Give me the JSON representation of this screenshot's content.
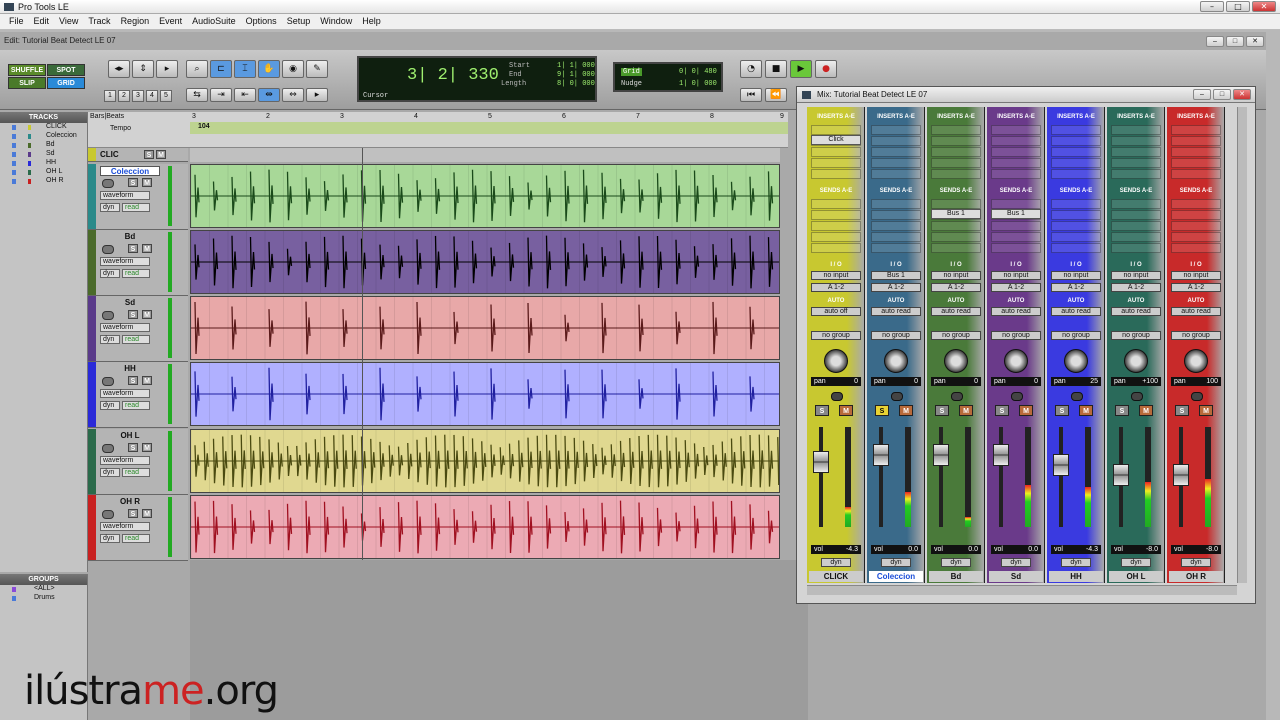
{
  "app_title": "Pro Tools LE",
  "menu": [
    "File",
    "Edit",
    "View",
    "Track",
    "Region",
    "Event",
    "AudioSuite",
    "Options",
    "Setup",
    "Window",
    "Help"
  ],
  "edit_window": {
    "title": "Edit: Tutorial Beat Detect LE 07"
  },
  "toolbar": {
    "modes": {
      "shuffle": "SHUFFLE",
      "spot": "SPOT",
      "slip": "SLIP",
      "grid": "GRID"
    },
    "zoom_presets": [
      "1",
      "2",
      "3",
      "4",
      "5"
    ],
    "counter": {
      "main": "3| 2| 330",
      "start_label": "Start",
      "end_label": "End",
      "length_label": "Length",
      "start": "1| 1| 000",
      "end": "9| 1| 000",
      "length": "8| 0| 000",
      "cursor_label": "Cursor"
    },
    "grid": {
      "label": "Grid",
      "value": "0| 0| 480"
    },
    "nudge": {
      "label": "Nudge",
      "value": "1| 0| 000"
    }
  },
  "tracks_panel": {
    "header": "TRACKS",
    "items": [
      "CLICK",
      "Coleccion",
      "Bd",
      "Sd",
      "HH",
      "OH L",
      "OH R"
    ]
  },
  "groups_panel": {
    "header": "GROUPS",
    "items": [
      "<ALL>",
      "Drums"
    ]
  },
  "ruler": {
    "bars_label": "Bars|Beats",
    "tempo_label": "Tempo",
    "tempo_value": "104",
    "bar_numbers": [
      "3",
      "2",
      "3",
      "4",
      "5",
      "6",
      "7",
      "8",
      "9"
    ]
  },
  "edit_tracks": [
    {
      "name": "CLIC",
      "color": "#c8c830"
    },
    {
      "name": "Coleccion",
      "view": "waveform",
      "auto": "read",
      "color": "#2a8a8a",
      "lane": "#a8d898",
      "wave": "#1a4a1a",
      "selected": true
    },
    {
      "name": "Bd",
      "view": "waveform",
      "auto": "read",
      "color": "#4a6a2a",
      "lane": "#7860a0",
      "wave": "#000"
    },
    {
      "name": "Sd",
      "view": "waveform",
      "auto": "read",
      "color": "#5a3a8a",
      "lane": "#e8a8a8",
      "wave": "#5a1a1a"
    },
    {
      "name": "HH",
      "view": "waveform",
      "auto": "read",
      "color": "#2a2ad8",
      "lane": "#b0b0ff",
      "wave": "#2020a0"
    },
    {
      "name": "OH L",
      "view": "waveform",
      "auto": "read",
      "color": "#2a6a4a",
      "lane": "#e0d890",
      "wave": "#4a4a10"
    },
    {
      "name": "OH R",
      "view": "waveform",
      "auto": "read",
      "color": "#c82020",
      "lane": "#ecaab4",
      "wave": "#a01020"
    }
  ],
  "track_controls": {
    "dyn": "dyn"
  },
  "mix_window": {
    "title": "Mix: Tutorial Beat Detect LE 07",
    "labels": {
      "inserts": "INSERTS A-E",
      "sends": "SENDS A-E",
      "io": "I / O",
      "auto": "AUTO",
      "pan": "pan",
      "vol": "vol",
      "dyn": "dyn",
      "group": "no group",
      "solo": "S",
      "mute": "M"
    },
    "strips": [
      {
        "name": "CLICK",
        "color": "#c8c830",
        "insert": "Click",
        "send": "",
        "input": "no input",
        "output": "A 1-2",
        "auto": "auto off",
        "pan": "0",
        "vol": "-4.3",
        "fader": 0.65,
        "meter": 0.2,
        "solo": false
      },
      {
        "name": "Coleccion",
        "color": "#3a6a8a",
        "insert": "",
        "send": "",
        "input": "Bus 1",
        "output": "A 1-2",
        "auto": "auto read",
        "pan": "0",
        "vol": "0.0",
        "fader": 0.72,
        "meter": 0.35,
        "solo": true,
        "selected": true
      },
      {
        "name": "Bd",
        "color": "#4a7a3a",
        "insert": "",
        "send": "Bus 1",
        "input": "no input",
        "output": "A 1-2",
        "auto": "auto read",
        "pan": "0",
        "vol": "0.0",
        "fader": 0.72,
        "meter": 0.1,
        "solo": false
      },
      {
        "name": "Sd",
        "color": "#6a3a8a",
        "insert": "",
        "send": "Bus 1",
        "input": "no input",
        "output": "A 1-2",
        "auto": "auto read",
        "pan": "0",
        "vol": "0.0",
        "fader": 0.72,
        "meter": 0.42,
        "solo": false
      },
      {
        "name": "HH",
        "color": "#3a3ae0",
        "insert": "",
        "send": "",
        "input": "no input",
        "output": "A 1-2",
        "auto": "auto read",
        "pan": "25",
        "vol": "-4.3",
        "fader": 0.62,
        "meter": 0.4,
        "solo": false
      },
      {
        "name": "OH L",
        "color": "#2a6a5a",
        "insert": "",
        "send": "",
        "input": "no input",
        "output": "A 1-2",
        "auto": "auto read",
        "pan": "+100",
        "vol": "-8.0",
        "fader": 0.52,
        "meter": 0.45,
        "solo": false
      },
      {
        "name": "OH R",
        "color": "#c82a2a",
        "insert": "",
        "send": "",
        "input": "no input",
        "output": "A 1-2",
        "auto": "auto read",
        "pan": "100",
        "vol": "-8.0",
        "fader": 0.52,
        "meter": 0.48,
        "solo": false
      }
    ]
  },
  "watermark": {
    "pre": "ilústra",
    "accent": "me",
    "post": ".org"
  },
  "colors": {
    "selected": "#1a4dd8",
    "solo_on": "#e8d233",
    "lcd_text": "#9fef6f"
  }
}
